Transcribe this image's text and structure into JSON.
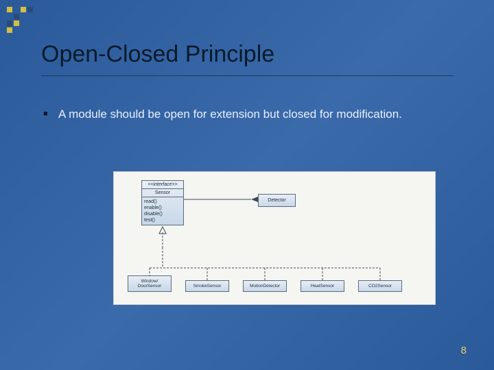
{
  "title": "Open-Closed Principle",
  "bullet": "A module should be open for extension but closed for modification.",
  "diagram": {
    "interface": {
      "stereotype": "<<interface>>",
      "name": "Sensor",
      "ops": [
        "read()",
        "enable()",
        "disable()",
        "test()"
      ]
    },
    "client": "Detector",
    "subclasses": [
      "Window/\nDoorSensor",
      "SmokeSensor",
      "MotionDetector",
      "HeatSensor",
      "CO2Sensor"
    ]
  },
  "pageNumber": "8"
}
